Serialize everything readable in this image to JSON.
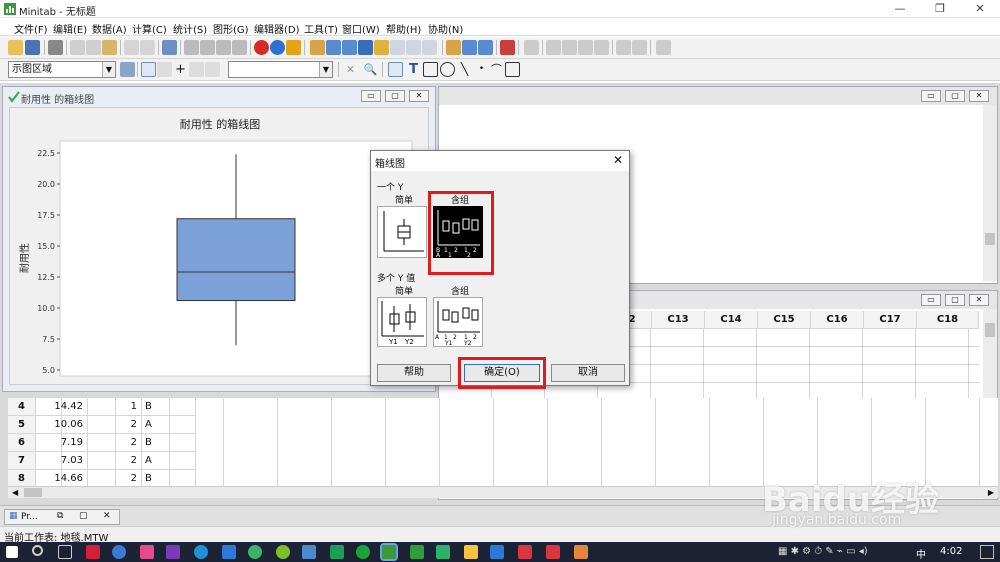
{
  "window": {
    "app_title": "Minitab - 无标题"
  },
  "menu": [
    "文件(F)",
    "编辑(E)",
    "数据(A)",
    "计算(C)",
    "统计(S)",
    "图形(G)",
    "编辑器(D)",
    "工具(T)",
    "窗口(W)",
    "帮助(H)",
    "协助(N)"
  ],
  "toolbar2": {
    "region_combo": "示图区域",
    "blank_combo": ""
  },
  "graph_window": {
    "title": "耐用性 的箱线图",
    "chart_title": "耐用性 的箱线图"
  },
  "chart_data": {
    "type": "box",
    "title": "耐用性 的箱线图",
    "ylabel": "耐用性",
    "yticks": [
      "5.0",
      "7.5",
      "10.0",
      "12.5",
      "15.0",
      "17.5",
      "20.0",
      "22.5"
    ],
    "ylim": [
      5.0,
      22.5
    ],
    "whisker_low": 7.0,
    "q1": 10.6,
    "median": 12.9,
    "q3": 17.2,
    "whisker_high": 22.4,
    "color": "#7ba1d8"
  },
  "worksheet": {
    "col_headers": [
      "C12",
      "C13",
      "C14",
      "C15",
      "C16",
      "C17",
      "C18"
    ]
  },
  "data_rows": [
    {
      "row": "4",
      "c1": "14.42",
      "c2": "1",
      "c3": "B"
    },
    {
      "row": "5",
      "c1": "10.06",
      "c2": "2",
      "c3": "A"
    },
    {
      "row": "6",
      "c1": "7.19",
      "c2": "2",
      "c3": "B"
    },
    {
      "row": "7",
      "c1": "7.03",
      "c2": "2",
      "c3": "A"
    },
    {
      "row": "8",
      "c1": "14.66",
      "c2": "2",
      "c3": "B"
    }
  ],
  "dialog": {
    "title": "箱线图",
    "section_one_y": "一个 Y",
    "simple": "简单",
    "with_groups": "含组",
    "section_multi_y": "多个 Y 值",
    "simple2": "简单",
    "with_groups2": "含组",
    "btn_help": "帮助",
    "btn_ok": "确定(O)",
    "btn_cancel": "取消",
    "icon_labels": {
      "b": "B",
      "a": "A",
      "n1": "1",
      "n2": "2",
      "y1": "Y1",
      "y2": "Y2"
    }
  },
  "tabsbar": {
    "tab1": "Pr..."
  },
  "status": {
    "text": "当前工作表: 地毯.MTW"
  },
  "taskbar": {
    "time": "4:02",
    "ime": "中"
  },
  "watermark": {
    "main": "Baidu经验",
    "sub": "jingyan.baidu.com"
  },
  "colors": {
    "highlight": "#e01b1b",
    "box_fill": "#7ba1d8",
    "taskbar": "#1b2233"
  }
}
